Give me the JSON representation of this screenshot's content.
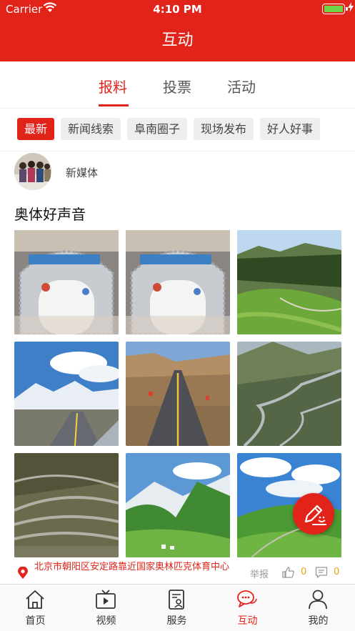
{
  "status_bar": {
    "carrier": "Carrier",
    "time": "4:10 PM"
  },
  "header": {
    "title": "互动"
  },
  "tabs": [
    {
      "label": "报料",
      "active": true
    },
    {
      "label": "投票",
      "active": false
    },
    {
      "label": "活动",
      "active": false
    }
  ],
  "filters": [
    {
      "label": "最新",
      "active": true
    },
    {
      "label": "新闻线索",
      "active": false
    },
    {
      "label": "阜南圈子",
      "active": false
    },
    {
      "label": "现场发布",
      "active": false
    },
    {
      "label": "好人好事",
      "active": false
    }
  ],
  "post": {
    "author": "新媒体",
    "title": "奥体好声音",
    "photo_count": 9,
    "location": "北京市朝阳区安定路靠近国家奥林匹克体育中心",
    "report_label": "举报",
    "likes": "0",
    "comments": "0"
  },
  "bottom_nav": [
    {
      "label": "首页",
      "icon": "home-icon",
      "active": false
    },
    {
      "label": "视频",
      "icon": "tv-icon",
      "active": false
    },
    {
      "label": "服务",
      "icon": "service-icon",
      "active": false
    },
    {
      "label": "互动",
      "icon": "chat-icon",
      "active": true
    },
    {
      "label": "我的",
      "icon": "profile-icon",
      "active": false
    }
  ],
  "colors": {
    "brand": "#e2231a",
    "count": "#e8a316",
    "battery": "#6fd54a"
  }
}
